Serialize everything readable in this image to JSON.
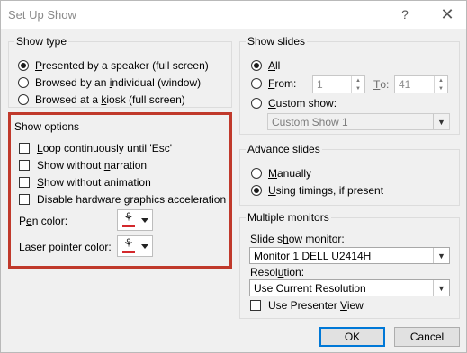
{
  "window": {
    "title": "Set Up Show",
    "help_icon": "?",
    "close_icon": "✕"
  },
  "show_type": {
    "label": "Show type",
    "options": [
      {
        "pre": "",
        "key": "P",
        "post": "resented by a speaker (full screen)",
        "selected": true
      },
      {
        "pre": "Browsed by an ",
        "key": "i",
        "post": "ndividual (window)",
        "selected": false
      },
      {
        "pre": "Browsed at a ",
        "key": "k",
        "post": "iosk (full screen)",
        "selected": false
      }
    ]
  },
  "show_options": {
    "label": "Show options",
    "loop": {
      "pre": "",
      "key": "L",
      "post": "oop continuously until 'Esc'",
      "checked": false
    },
    "narration": {
      "pre": "Show without ",
      "key": "n",
      "post": "arration",
      "checked": false
    },
    "animation": {
      "pre": "",
      "key": "S",
      "post": "how without animation",
      "checked": false
    },
    "hw_accel": {
      "pre": "Disable hardware ",
      "key": "g",
      "post": "raphics acceleration",
      "checked": false
    },
    "pen_color": {
      "pre": "P",
      "key": "e",
      "post": "n color:",
      "color": "#d3282c"
    },
    "laser_color": {
      "pre": "La",
      "key": "s",
      "post": "er pointer color:",
      "color": "#d3282c"
    },
    "highlight_color": "#c0392b"
  },
  "show_slides": {
    "label": "Show slides",
    "all": {
      "pre": "",
      "key": "A",
      "post": "ll",
      "selected": true
    },
    "from": {
      "pre": "",
      "key": "F",
      "post": "rom:",
      "selected": false,
      "value": "1"
    },
    "to": {
      "pre": "",
      "key": "T",
      "post": "o:",
      "value": "41"
    },
    "custom": {
      "pre": "",
      "key": "C",
      "post": "ustom show:",
      "selected": false,
      "value": "Custom Show 1"
    }
  },
  "advance_slides": {
    "label": "Advance slides",
    "manually": {
      "pre": "",
      "key": "M",
      "post": "anually",
      "selected": false
    },
    "timings": {
      "pre": "",
      "key": "U",
      "post": "sing timings, if present",
      "selected": true
    }
  },
  "multiple_monitors": {
    "label": "Multiple monitors",
    "monitor_label": {
      "pre": "Slide s",
      "key": "h",
      "post": "ow monitor:"
    },
    "monitor_value": "Monitor 1 DELL U2414H",
    "resolution_label": {
      "pre": "Resol",
      "key": "u",
      "post": "tion:"
    },
    "resolution_value": "Use Current Resolution",
    "presenter_view": {
      "pre": "Use Presenter ",
      "key": "V",
      "post": "iew",
      "checked": false
    }
  },
  "buttons": {
    "ok": "OK",
    "cancel": "Cancel"
  }
}
